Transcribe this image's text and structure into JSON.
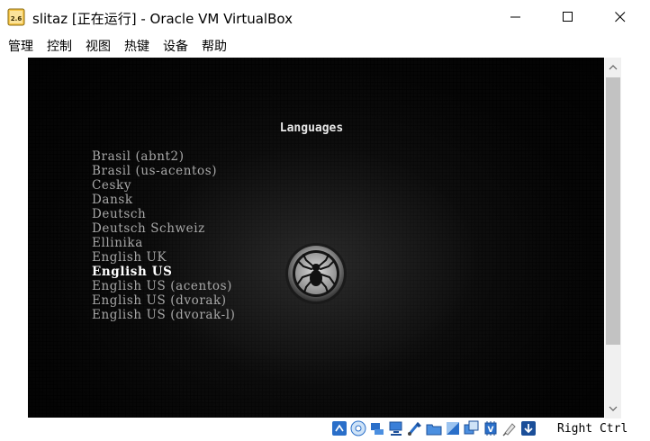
{
  "window": {
    "title": "slitaz [正在运行] - Oracle VM VirtualBox",
    "app_icon_text": "2.6",
    "controls": [
      "minimize-icon",
      "maximize-icon",
      "close-icon"
    ]
  },
  "menu": {
    "items": [
      "管理",
      "控制",
      "视图",
      "热键",
      "设备",
      "帮助"
    ]
  },
  "vm_screen": {
    "heading": "Languages",
    "selected_index": 8,
    "languages": [
      "Brasil (abnt2)",
      "Brasil (us-acentos)",
      "Cesky",
      "Dansk",
      "Deutsch",
      "Deutsch Schweiz",
      "Ellinika",
      "English UK",
      "English US",
      "English US (acentos)",
      "English US (dvorak)",
      "English US (dvorak-l)"
    ],
    "logo": "spider-icon"
  },
  "statusbar": {
    "icons": [
      "hard-disk-icon",
      "optical-disk-icon",
      "audio-icon",
      "network-icon",
      "usb-icon",
      "shared-folders-icon",
      "display-icon",
      "video-capture-icon",
      "cpu-icon",
      "mouse-integration-icon",
      "keyboard-capture-icon"
    ],
    "host_key": "Right Ctrl"
  },
  "colors": {
    "vm_background": "#0a0a0a",
    "menu_text": "#000000",
    "list_text": "#a8a8a8",
    "selected_text": "#ffffff",
    "scroll_thumb": "#c2c2c2"
  }
}
